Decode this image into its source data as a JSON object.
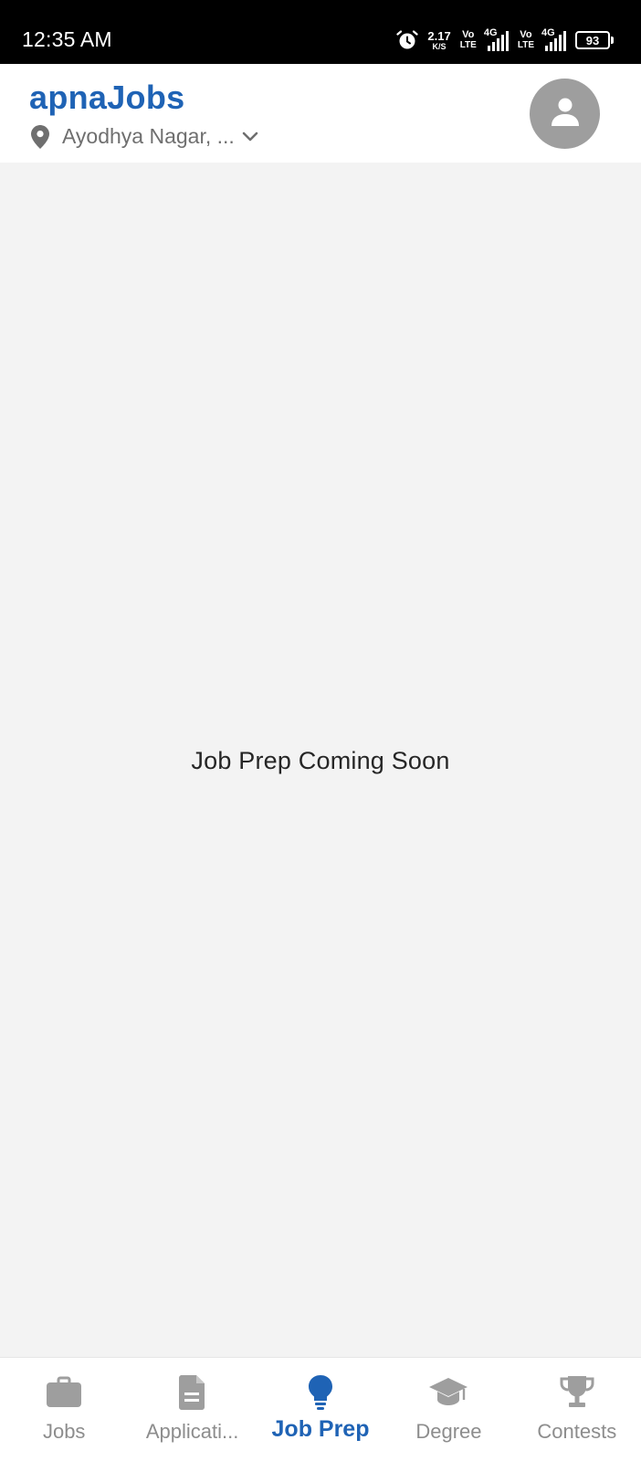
{
  "status_bar": {
    "time": "12:35 AM",
    "net_speed_value": "2.17",
    "net_speed_unit": "K/S",
    "sim1_volte_top": "Vo",
    "sim1_volte_bottom": "LTE",
    "sim1_network": "4G",
    "sim2_volte_top": "Vo",
    "sim2_volte_bottom": "LTE",
    "sim2_network": "4G",
    "battery_level": "93"
  },
  "header": {
    "app_title": "apnaJobs",
    "location_text": "Ayodhya Nagar, ...",
    "accent_color": "#1f63b5"
  },
  "main": {
    "message": "Job Prep Coming Soon"
  },
  "bottom_nav": {
    "active_color": "#1f63b5",
    "inactive_color": "#8d8d8d",
    "items": [
      {
        "label": "Jobs",
        "icon": "briefcase-icon",
        "active": false
      },
      {
        "label": "Applicati...",
        "icon": "document-icon",
        "active": false
      },
      {
        "label": "Job Prep",
        "icon": "lightbulb-icon",
        "active": true
      },
      {
        "label": "Degree",
        "icon": "graduation-cap-icon",
        "active": false
      },
      {
        "label": "Contests",
        "icon": "trophy-icon",
        "active": false
      }
    ]
  }
}
